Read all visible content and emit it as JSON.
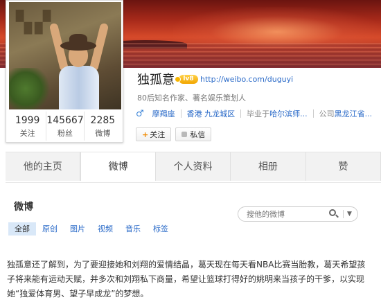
{
  "profile": {
    "name": "独孤意",
    "badge": "lv8",
    "home_url": "http://weibo.com/duguyi",
    "description": "80后知名作家、著名娱乐策划人",
    "gender_symbol": "♂",
    "zodiac": "摩羯座",
    "location": "香港 九龙城区",
    "school_prefix": "毕业于",
    "school": "哈尔滨师...",
    "company_prefix": "公司",
    "company": "黑龙江省..."
  },
  "stats": [
    {
      "value": "1999",
      "label": "关注"
    },
    {
      "value": "145667",
      "label": "粉丝"
    },
    {
      "value": "2285",
      "label": "微博"
    }
  ],
  "actions": {
    "follow_label": "关注",
    "follow_plus": "+",
    "message_label": "私信"
  },
  "tabs": [
    {
      "label": "他的主页"
    },
    {
      "label": "微博"
    },
    {
      "label": "个人资料"
    },
    {
      "label": "相册"
    },
    {
      "label": "赞"
    }
  ],
  "feed": {
    "title": "微博",
    "search_placeholder": "搜他的微博",
    "filters": [
      "全部",
      "原创",
      "图片",
      "视频",
      "音乐",
      "标签"
    ],
    "post_text": "独孤意还了解到，为了要迎接她和刘翔的爱情结晶，葛天现在每天看NBA比赛当胎教，葛天希望孩子将来能有运动天赋，并多次和刘翔私下商量，希望让篮球打得好的姚明来当孩子的干爹，以实现她“独爱体育男、望子早成龙”的梦想。"
  },
  "colors": {
    "link": "#2a6ac8",
    "follow_plus": "#f08a00",
    "badge": "#f2a500",
    "tab_bg": "#f2f2f2",
    "filter_active_bg": "#d9e8f8"
  }
}
